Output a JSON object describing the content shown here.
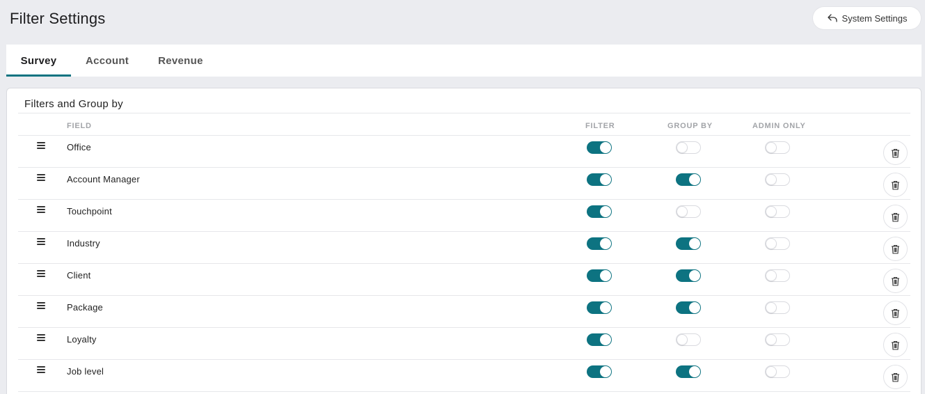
{
  "page": {
    "title": "Filter Settings"
  },
  "header": {
    "system_settings_label": "System Settings",
    "system_settings_icon": "reply-arrow-icon"
  },
  "tabs": [
    {
      "label": "Survey",
      "active": true
    },
    {
      "label": "Account",
      "active": false
    },
    {
      "label": "Revenue",
      "active": false
    }
  ],
  "section": {
    "title": "Filters and Group by",
    "columns": {
      "field": "FIELD",
      "filter": "FILTER",
      "group_by": "GROUP BY",
      "admin_only": "ADMIN ONLY"
    }
  },
  "rows": [
    {
      "field": "Office",
      "filter": true,
      "group_by": false,
      "admin_only": false
    },
    {
      "field": "Account Manager",
      "filter": true,
      "group_by": true,
      "admin_only": false
    },
    {
      "field": "Touchpoint",
      "filter": true,
      "group_by": false,
      "admin_only": false
    },
    {
      "field": "Industry",
      "filter": true,
      "group_by": true,
      "admin_only": false
    },
    {
      "field": "Client",
      "filter": true,
      "group_by": true,
      "admin_only": false
    },
    {
      "field": "Package",
      "filter": true,
      "group_by": true,
      "admin_only": false
    },
    {
      "field": "Loyalty",
      "filter": true,
      "group_by": false,
      "admin_only": false
    },
    {
      "field": "Job level",
      "filter": true,
      "group_by": true,
      "admin_only": false
    }
  ],
  "colors": {
    "accent": "#0d7381",
    "background": "#ebecf0"
  }
}
